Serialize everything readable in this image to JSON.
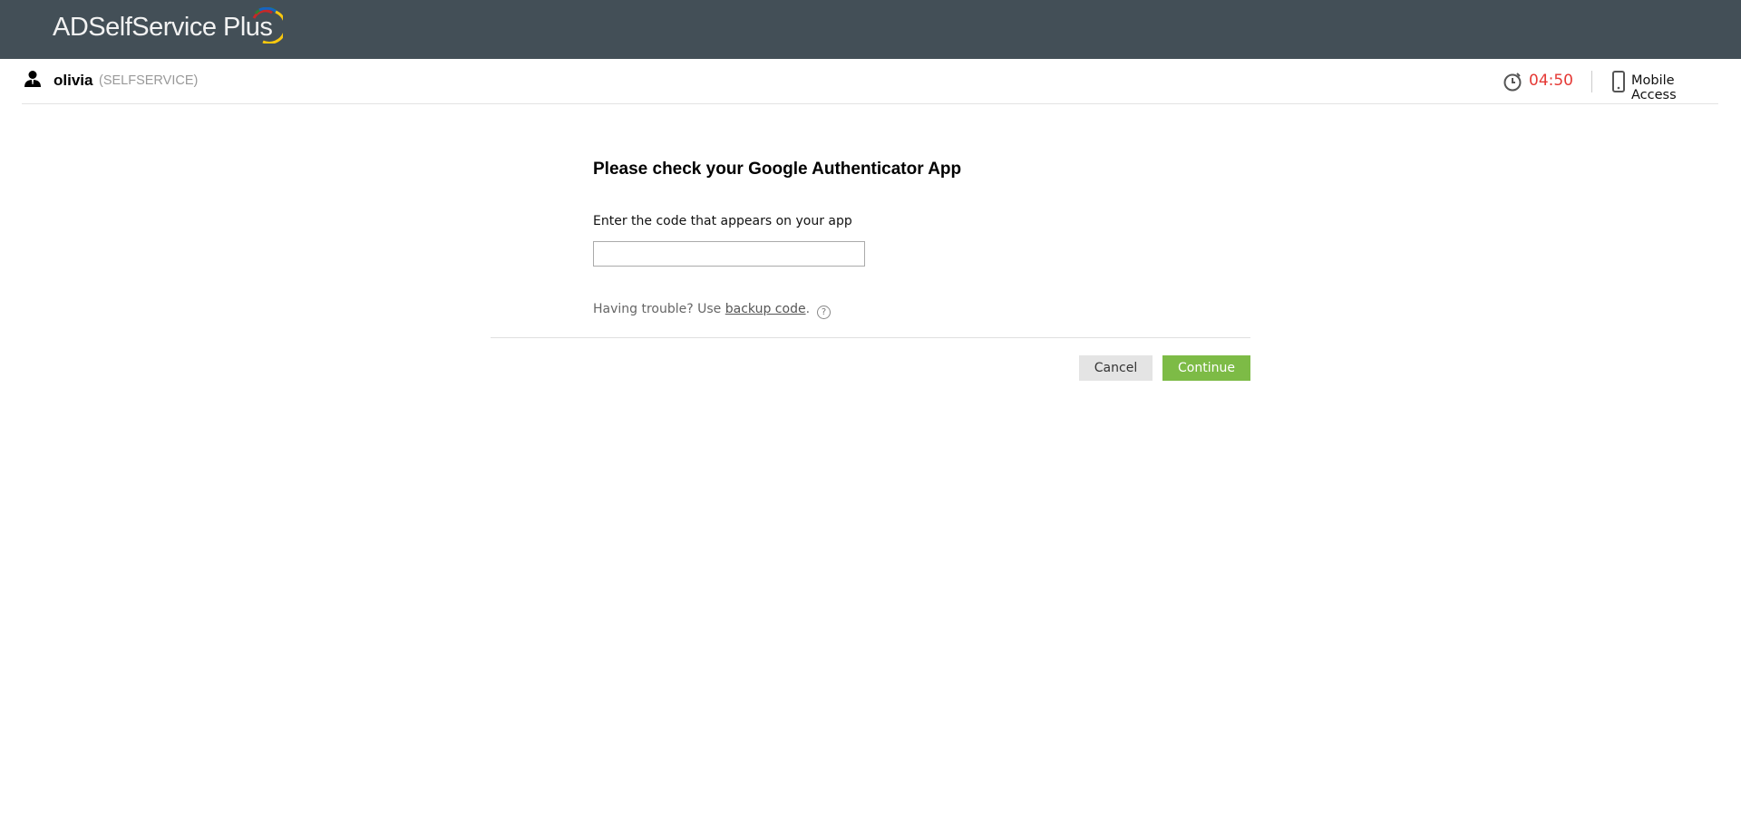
{
  "header": {
    "app_name": "ADSelfService Plus"
  },
  "user": {
    "name": "olivia",
    "domain": "(SELFSERVICE)"
  },
  "session": {
    "timer": "04:50",
    "mobile_access": "Mobile Access"
  },
  "form": {
    "title": "Please check your Google Authenticator App",
    "code_label": "Enter the code that appears on your app",
    "code_value": "",
    "trouble_text": "Having trouble? Use ",
    "backup_link": "backup code",
    "trouble_end": ".",
    "help": "?"
  },
  "buttons": {
    "cancel": "Cancel",
    "continue": "Continue"
  },
  "colors": {
    "header_bg": "#434f57",
    "timer": "#e53935",
    "continue": "#7dbb46"
  }
}
